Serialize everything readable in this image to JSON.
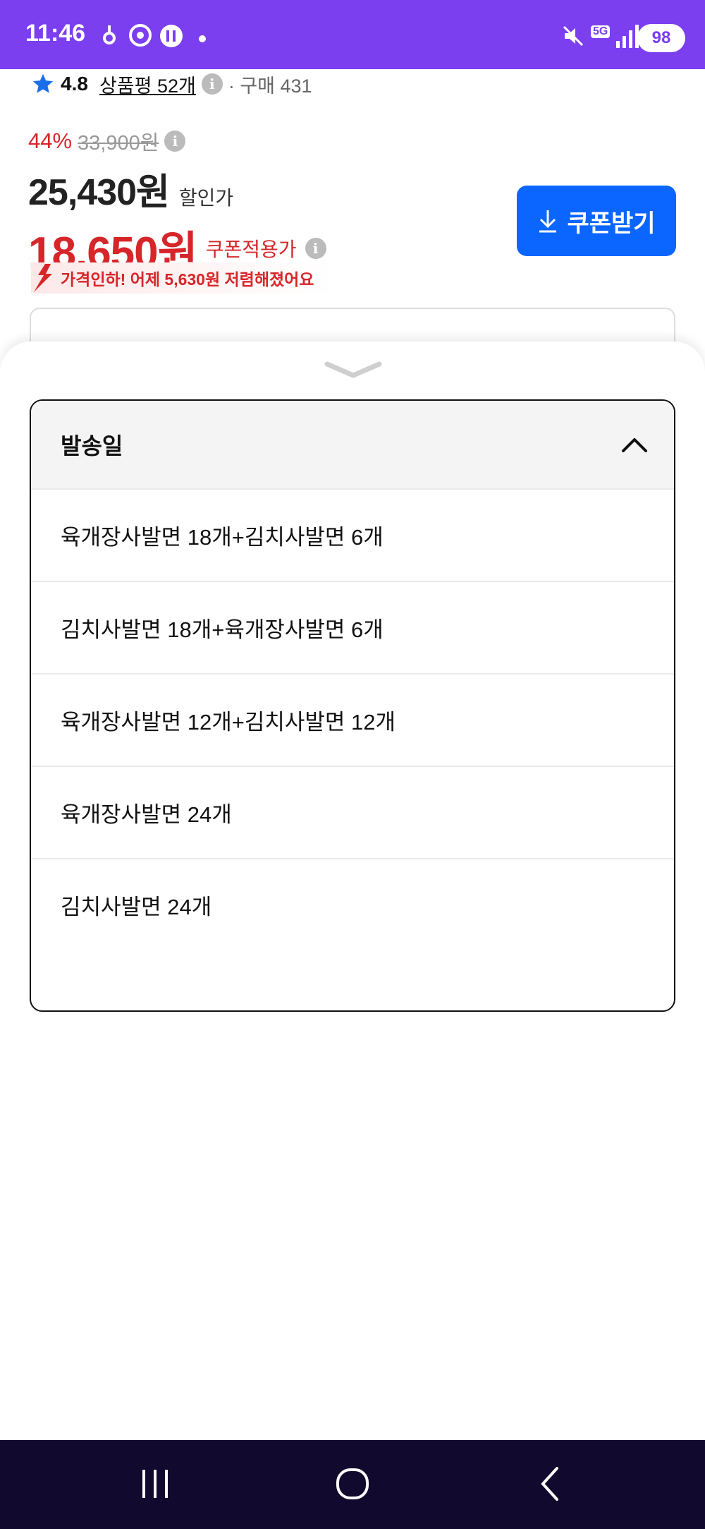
{
  "status_bar": {
    "time": "11:46",
    "battery": "98",
    "network": "5G",
    "icons": [
      "notification-icon",
      "chrome-icon",
      "app-icon",
      "dot-icon",
      "mute-icon",
      "signal-icon"
    ]
  },
  "product": {
    "rating": "4.8",
    "reviews": "상품평 52개",
    "purchases": "구매 431",
    "discount_rate": "44%",
    "original_price": "33,900원",
    "sale_price": "25,430원",
    "sale_label": "할인가",
    "coupon_price": "18,650원",
    "coupon_label": "쿠폰적용가",
    "price_drop": "가격인하! 어제 5,630원 저렴해졌어요",
    "coupon_button": "쿠폰받기",
    "info_glyph": "i"
  },
  "sheet": {
    "title": "발송일",
    "options": [
      "육개장사발면 18개+김치사발면 6개",
      "김치사발면 18개+육개장사발면 6개",
      "육개장사발면 12개+김치사발면 12개",
      "육개장사발면 24개",
      "김치사발면 24개"
    ]
  },
  "colors": {
    "status_bar": "#7b3ff0",
    "price_red": "#d6262a",
    "coupon_blue": "#0a66ff",
    "nav_bar": "#120a2e"
  }
}
